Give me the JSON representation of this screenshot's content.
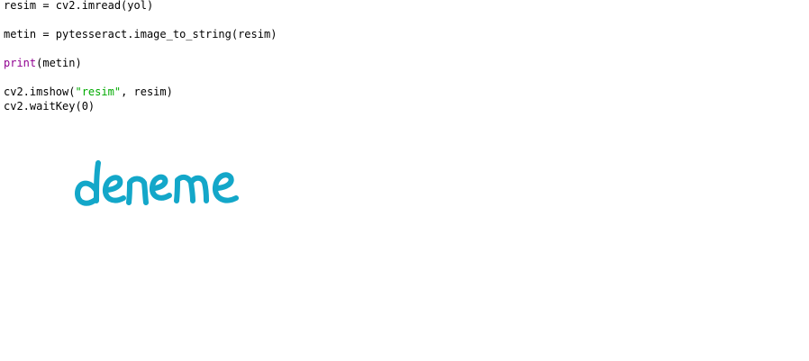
{
  "code": {
    "line1": "resim = cv2.imread(yol)",
    "line3": "metin = pytesseract.image_to_string(resim)",
    "line5_builtin": "print",
    "line5_rest": "(metin)",
    "line7_prefix": "cv2.imshow(",
    "line7_string": "\"resim\"",
    "line7_suffix": ", resim)",
    "line8": "cv2.waitKey(0)"
  },
  "handwriting": {
    "text": "deneme",
    "color": "#13a7c9"
  }
}
